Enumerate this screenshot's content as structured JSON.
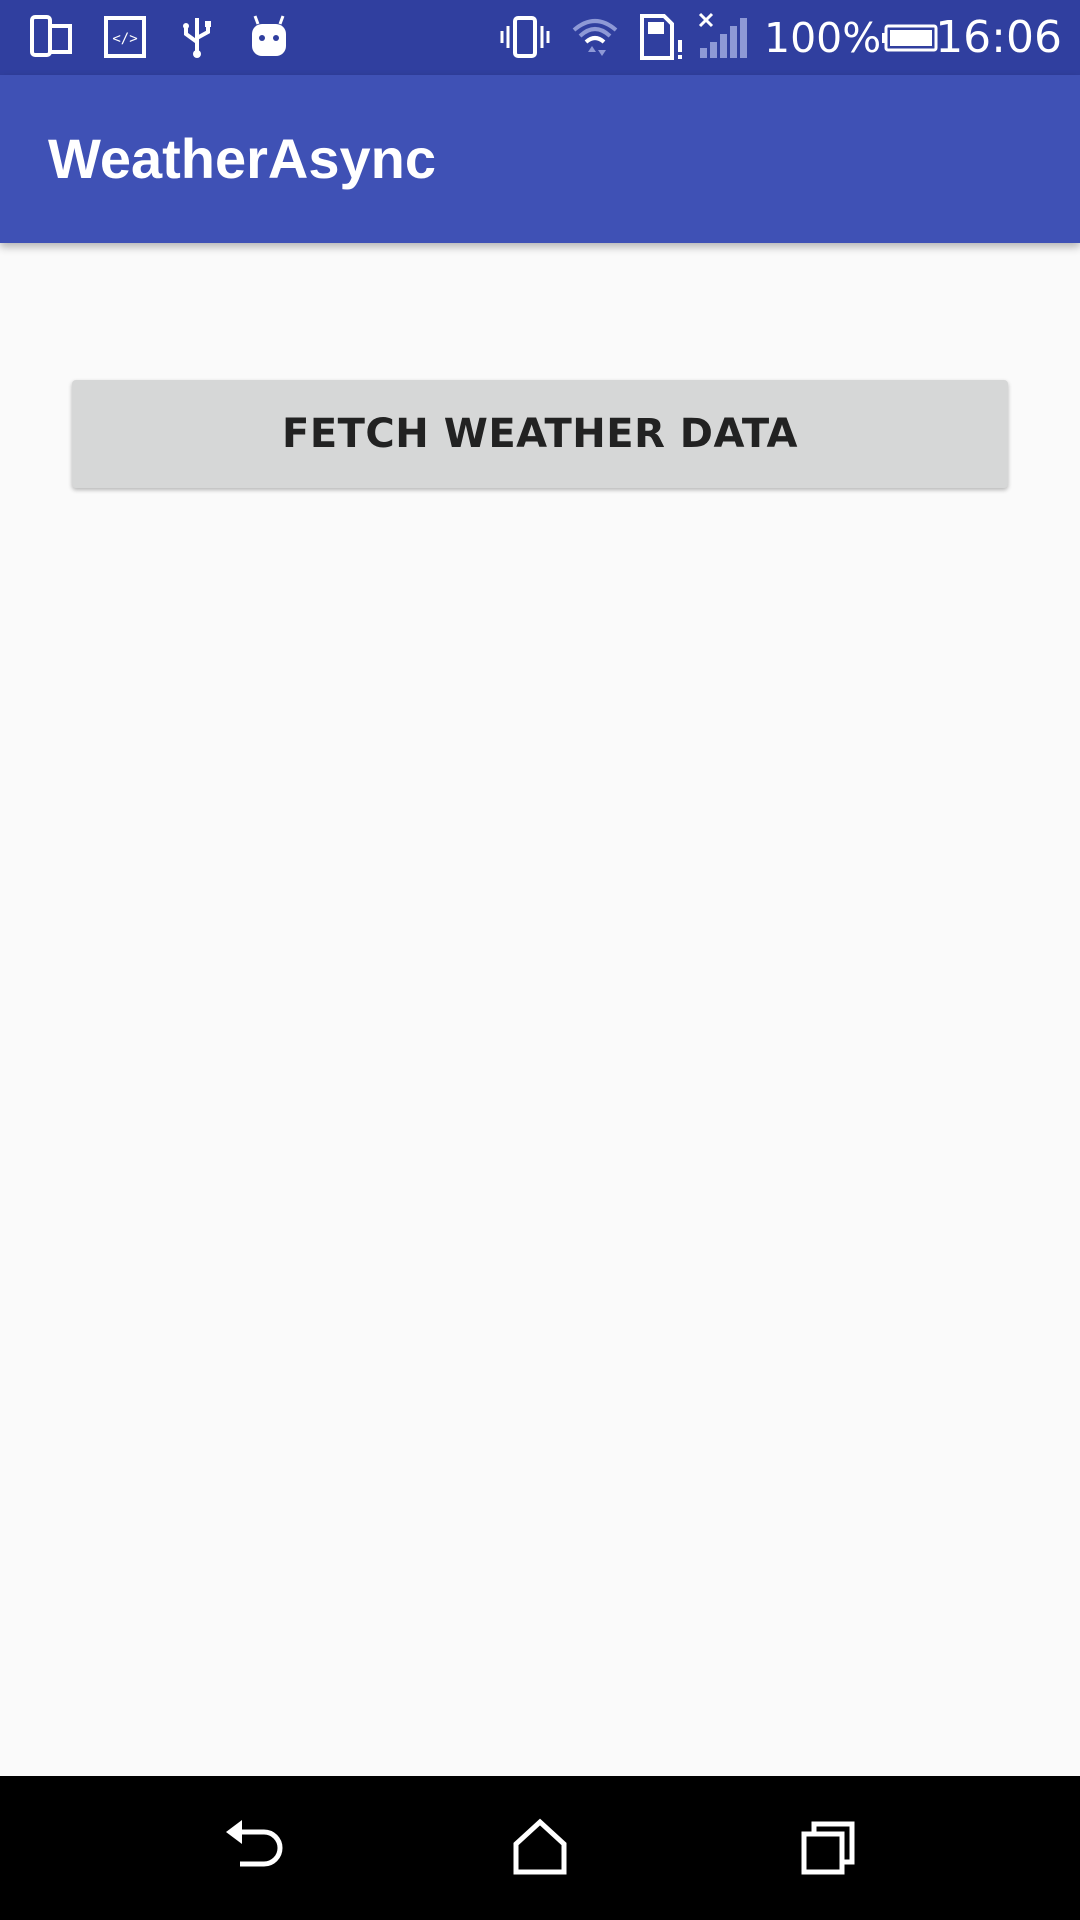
{
  "status_bar": {
    "left_icons": [
      "device-mirror-icon",
      "code-icon",
      "usb-icon",
      "android-debug-icon"
    ],
    "right_icons": [
      "vibrate-icon",
      "wifi-icon",
      "sim-alert-icon",
      "signal-icon",
      "battery-icon"
    ],
    "battery_percent": "100%",
    "time": "16:06",
    "background_color": "#303f9f"
  },
  "app_bar": {
    "title": "WeatherAsync",
    "background_color": "#3f51b5"
  },
  "main": {
    "fetch_button_label": "FETCH WEATHER DATA"
  },
  "nav_bar": {
    "buttons": [
      "back-icon",
      "home-icon",
      "recents-icon"
    ]
  }
}
